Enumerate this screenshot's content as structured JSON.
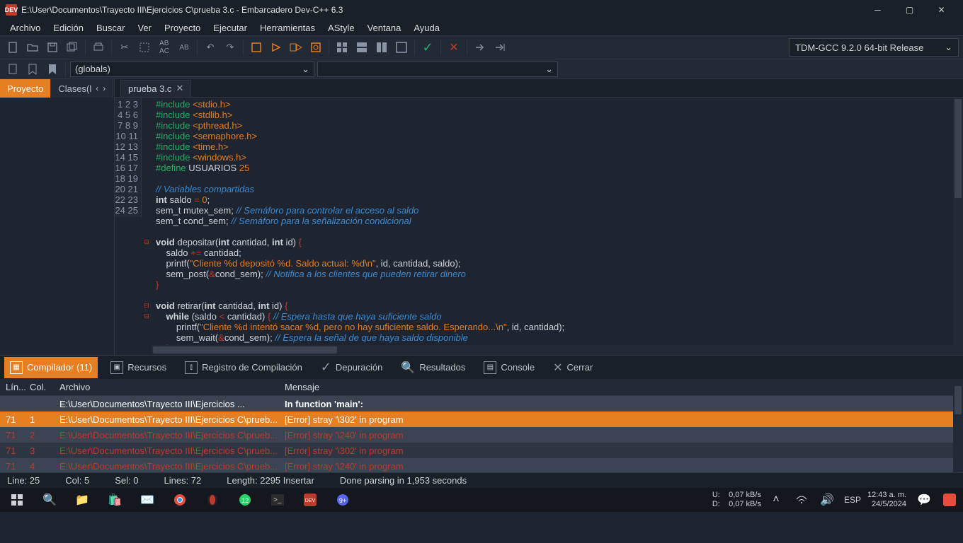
{
  "titlebar": {
    "icon_text": "DEV",
    "title": "E:\\User\\Documentos\\Trayecto III\\Ejercicios C\\prueba 3.c - Embarcadero Dev-C++ 6.3"
  },
  "menu": [
    "Archivo",
    "Edición",
    "Buscar",
    "Ver",
    "Proyecto",
    "Ejecutar",
    "Herramientas",
    "AStyle",
    "Ventana",
    "Ayuda"
  ],
  "compiler": "TDM-GCC 9.2.0 64-bit Release",
  "globals": "(globals)",
  "side_tabs": {
    "active": "Proyecto",
    "other": "Clases(l"
  },
  "file_tab": "prueba 3.c",
  "code_lines": [
    1,
    2,
    3,
    4,
    5,
    6,
    7,
    8,
    9,
    10,
    11,
    12,
    13,
    14,
    15,
    16,
    17,
    18,
    19,
    20,
    21,
    22,
    23,
    24,
    25
  ],
  "bottom_tabs": {
    "compilador": "Compilador (11)",
    "recursos": "Recursos",
    "registro": "Registro de Compilación",
    "depuracion": "Depuración",
    "resultados": "Resultados",
    "console": "Console",
    "cerrar": "Cerrar"
  },
  "err_headers": {
    "lin": "Lín...",
    "col": "Col.",
    "archivo": "Archivo",
    "mensaje": "Mensaje"
  },
  "errors": [
    {
      "lin": "",
      "col": "",
      "file": "E:\\User\\Documentos\\Trayecto III\\Ejercicios ...",
      "msg": "In function 'main':",
      "sel": false,
      "hdr": true
    },
    {
      "lin": "71",
      "col": "1",
      "file": "E:\\User\\Documentos\\Trayecto III\\Ejercicios C\\prueb...",
      "msg": "[Error] stray '\\302' in program",
      "sel": true,
      "hdr": false
    },
    {
      "lin": "71",
      "col": "2",
      "file": "E:\\User\\Documentos\\Trayecto III\\Ejercicios C\\prueb...",
      "msg": "[Error] stray '\\240' in program",
      "sel": false,
      "hdr": false
    },
    {
      "lin": "71",
      "col": "3",
      "file": "E:\\User\\Documentos\\Trayecto III\\Ejercicios C\\prueb...",
      "msg": "[Error] stray '\\302' in program",
      "sel": false,
      "hdr": false
    },
    {
      "lin": "71",
      "col": "4",
      "file": "E:\\User\\Documentos\\Trayecto III\\Ejercicios C\\prueb...",
      "msg": "[Error] stray '\\240' in program",
      "sel": false,
      "hdr": false
    }
  ],
  "status": {
    "line": "Line:   25",
    "col": "Col:   5",
    "sel": "Sel:   0",
    "lines": "Lines:   72",
    "length": "Length:  2295 Insertar",
    "done": "Done parsing in 1,953 seconds"
  },
  "sys": {
    "u": "U:",
    "d": "D:",
    "us": "0,07 kB/s",
    "ds": "0,07 kB/s",
    "lang": "ESP",
    "time": "12:43 a. m.",
    "date": "24/5/2024"
  }
}
